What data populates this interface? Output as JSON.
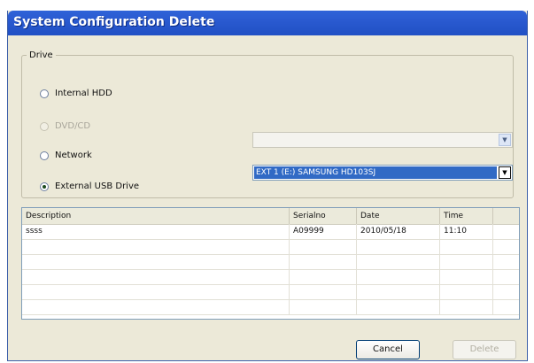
{
  "window": {
    "title": "System Configuration Delete"
  },
  "drive_group": {
    "legend": "Drive",
    "options": [
      {
        "label": "Internal HDD",
        "checked": false,
        "enabled": true
      },
      {
        "label": "DVD/CD",
        "checked": false,
        "enabled": false
      },
      {
        "label": "Network",
        "checked": false,
        "enabled": true
      },
      {
        "label": "External USB Drive",
        "checked": true,
        "enabled": true
      }
    ],
    "network_combo": {
      "value": "",
      "enabled": false
    },
    "usb_combo": {
      "value": "EXT 1 (E:) SAMSUNG HD103SJ",
      "selected": true
    }
  },
  "table": {
    "columns": [
      "Description",
      "Serialno",
      "Date",
      "Time"
    ],
    "rows": [
      {
        "description": "ssss",
        "serialno": "A09999",
        "date": "2010/05/18",
        "time": "11:10"
      }
    ]
  },
  "buttons": {
    "cancel": "Cancel",
    "delete": "Delete"
  },
  "colors": {
    "titlebar": "#2a5ad0",
    "selection": "#316ac5",
    "dialog_bg": "#ece9d8"
  }
}
